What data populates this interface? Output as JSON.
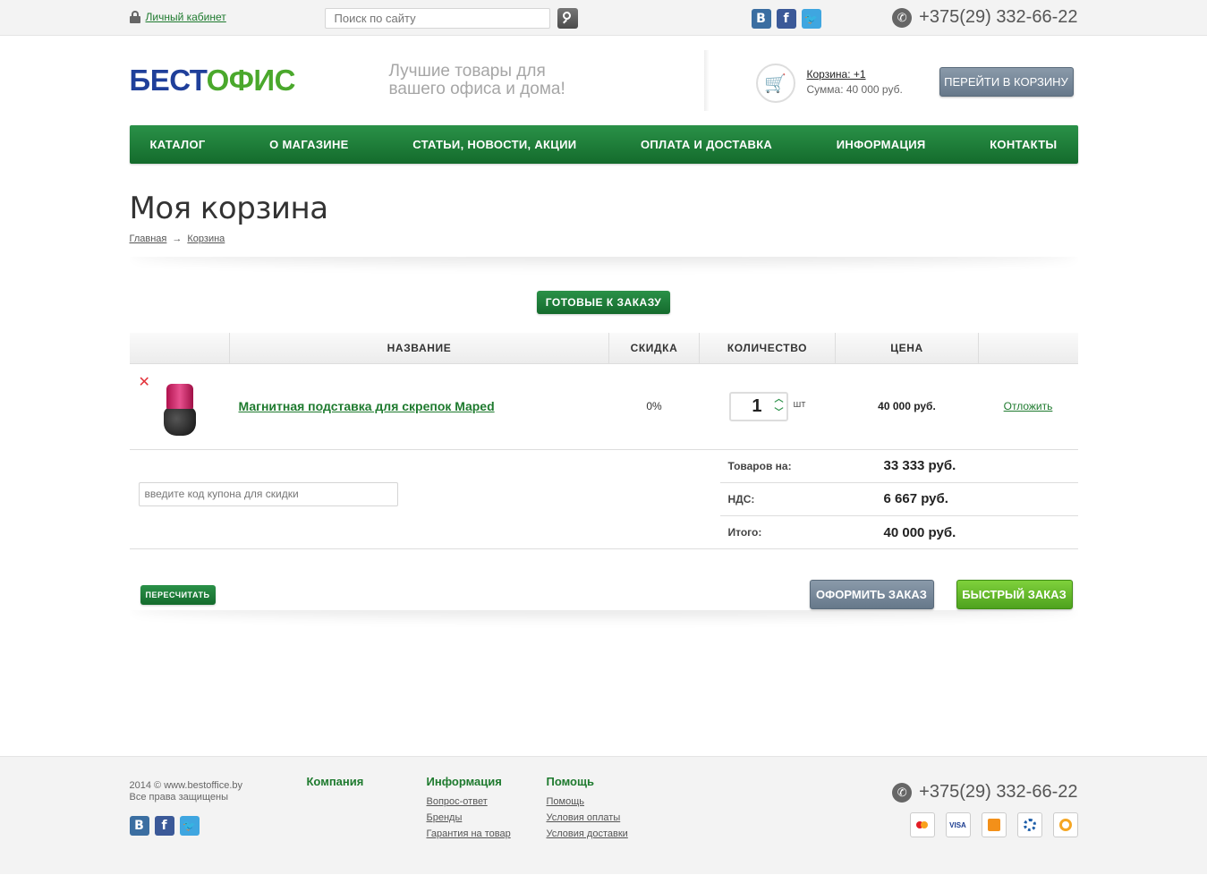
{
  "topbar": {
    "login_label": "Личный кабинет",
    "search_placeholder": "Поиск по сайту",
    "phone": "+375(29) 332-66-22"
  },
  "social": {
    "vk": "B",
    "fb": "f",
    "tw": "t"
  },
  "header": {
    "logo_part1": "БЕСТ",
    "logo_part2": "ОФИС",
    "slogan": "Лучшие товары для вашего офиса и дома!",
    "cart_label": "Корзина: +1",
    "cart_sum": "Сумма: 40 000 руб.",
    "go_cart_button": "ПЕРЕЙТИ В КОРЗИНУ"
  },
  "nav": {
    "items": [
      "КАТАЛОГ",
      "О МАГАЗИНЕ",
      "СТАТЬИ, НОВОСТИ, АКЦИИ",
      "ОПЛАТА И ДОСТАВКА",
      "ИНФОРМАЦИЯ",
      "КОНТАКТЫ"
    ]
  },
  "page": {
    "title": "Моя корзина",
    "breadcrumbs": [
      "Главная",
      "→",
      "Корзина"
    ],
    "ready_button": "ГОТОВЫЕ К ЗАКАЗУ"
  },
  "table": {
    "headers": [
      "",
      "НАЗВАНИЕ",
      "СКИДКА",
      "КОЛИЧЕСТВО",
      "ЦЕНА",
      ""
    ],
    "rows": [
      {
        "remove": "✕",
        "name": "Магнитная подставка для скрепок Maped",
        "discount": "0%",
        "quantity": "1",
        "unit": "шт",
        "price": "40 000 руб.",
        "defer": "Отложить"
      }
    ]
  },
  "summary": {
    "coupon_placeholder": "введите код купона для скидки",
    "goods_label": "Товаров на:",
    "goods_value": "33 333 руб.",
    "vat_label": "НДС:",
    "vat_value": "6 667 руб.",
    "total_label": "Итого:",
    "total_value": "40 000 руб."
  },
  "actions": {
    "recalc": "ПЕРЕСЧИТАТЬ",
    "order": "ОФОРМИТЬ ЗАКАЗ",
    "quick": "БЫСТРЫЙ ЗАКАЗ"
  },
  "footer": {
    "copyright": "2014 © www.bestoffice.by",
    "rights": "Все права защищены",
    "company_heading": "Компания",
    "info_heading": "Информация",
    "info_links": [
      "Вопрос-ответ",
      "Бренды",
      "Гарантия на товар"
    ],
    "help_heading": "Помощь",
    "help_links": [
      "Помощь",
      "Условия оплаты",
      "Условия доставки"
    ],
    "phone": "+375(29) 332-66-22",
    "payments": [
      "mastercard-icon",
      "visa-icon",
      "payment-system-icon",
      "webmoney-icon",
      "qiwi-icon"
    ],
    "payment_labels": [
      "MC",
      "VISA"
    ]
  },
  "colors": {
    "brand_green": "#1e7a2e",
    "nav_green": "#2a9148",
    "logo_blue": "#1f3f9a",
    "logo_green": "#4aa82c",
    "remove_red": "#e3323a"
  }
}
